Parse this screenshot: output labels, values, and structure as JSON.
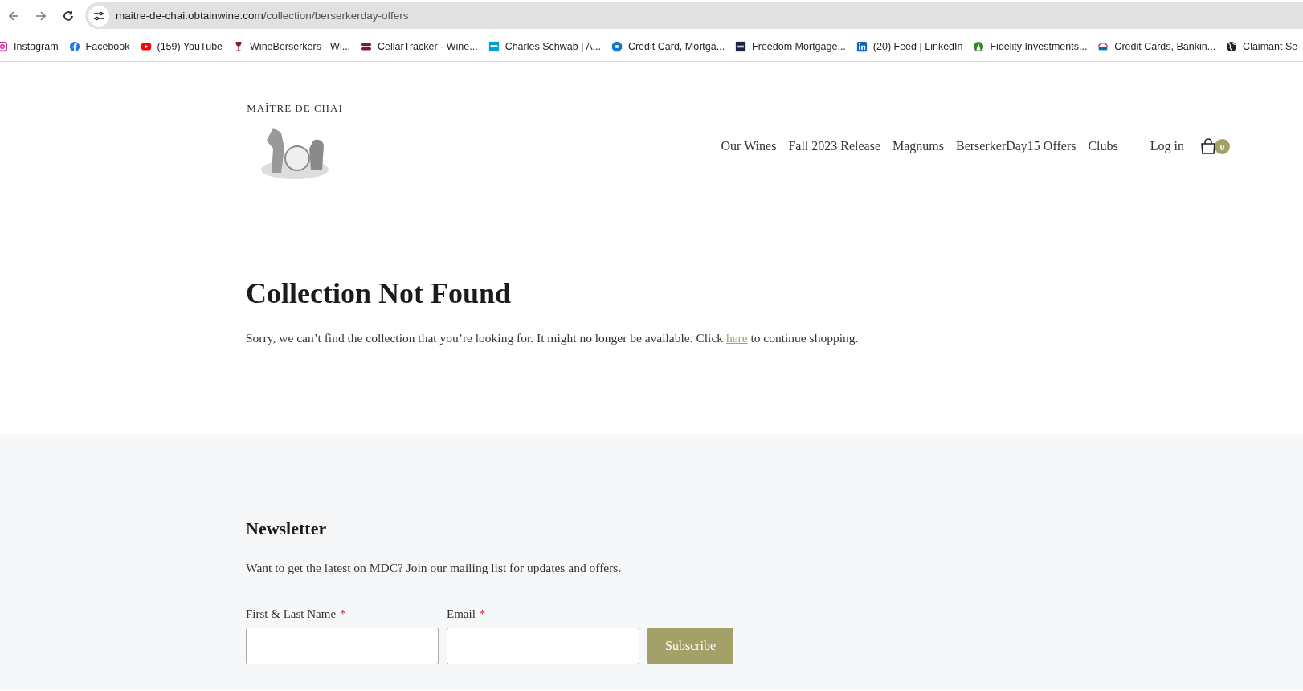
{
  "browser": {
    "url_domain": "maitre-de-chai.obtainwine.com",
    "url_path": "/collection/berserkerday-offers",
    "bookmarks": [
      {
        "label": "Instagram",
        "kind": "instagram"
      },
      {
        "label": "Facebook",
        "kind": "facebook"
      },
      {
        "label": "(159) YouTube",
        "kind": "youtube"
      },
      {
        "label": "WineBerserkers - Wi...",
        "kind": "wine"
      },
      {
        "label": "CellarTracker - Wine...",
        "kind": "cellar"
      },
      {
        "label": "Charles Schwab | A...",
        "kind": "schwab"
      },
      {
        "label": "Credit Card, Mortga...",
        "kind": "chase"
      },
      {
        "label": "Freedom Mortgage...",
        "kind": "fm"
      },
      {
        "label": "(20) Feed | LinkedIn",
        "kind": "linkedin"
      },
      {
        "label": "Fidelity Investments...",
        "kind": "fidelity"
      },
      {
        "label": "Credit Cards, Bankin...",
        "kind": "citi"
      },
      {
        "label": "Claimant Se",
        "kind": "globe"
      }
    ]
  },
  "header": {
    "logo_text": "MAÎTRE DE CHAI",
    "nav": [
      {
        "label": "Our Wines"
      },
      {
        "label": "Fall 2023 Release"
      },
      {
        "label": "Magnums"
      },
      {
        "label": "BerserkerDay15 Offers"
      },
      {
        "label": "Clubs"
      }
    ],
    "login": "Log in",
    "cart_count": "0"
  },
  "main": {
    "title": "Collection Not Found",
    "message_before": "Sorry, we can’t find the collection that you’re looking for. It might no longer be available. Click ",
    "link": "here",
    "message_after": " to continue shopping."
  },
  "newsletter": {
    "title": "Newsletter",
    "text": "Want to get the latest on MDC? Join our mailing list for updates and offers.",
    "fields": [
      {
        "label": "First & Last Name",
        "required_mark": "*"
      },
      {
        "label": "Email",
        "required_mark": "*"
      }
    ],
    "button": "Subscribe"
  }
}
